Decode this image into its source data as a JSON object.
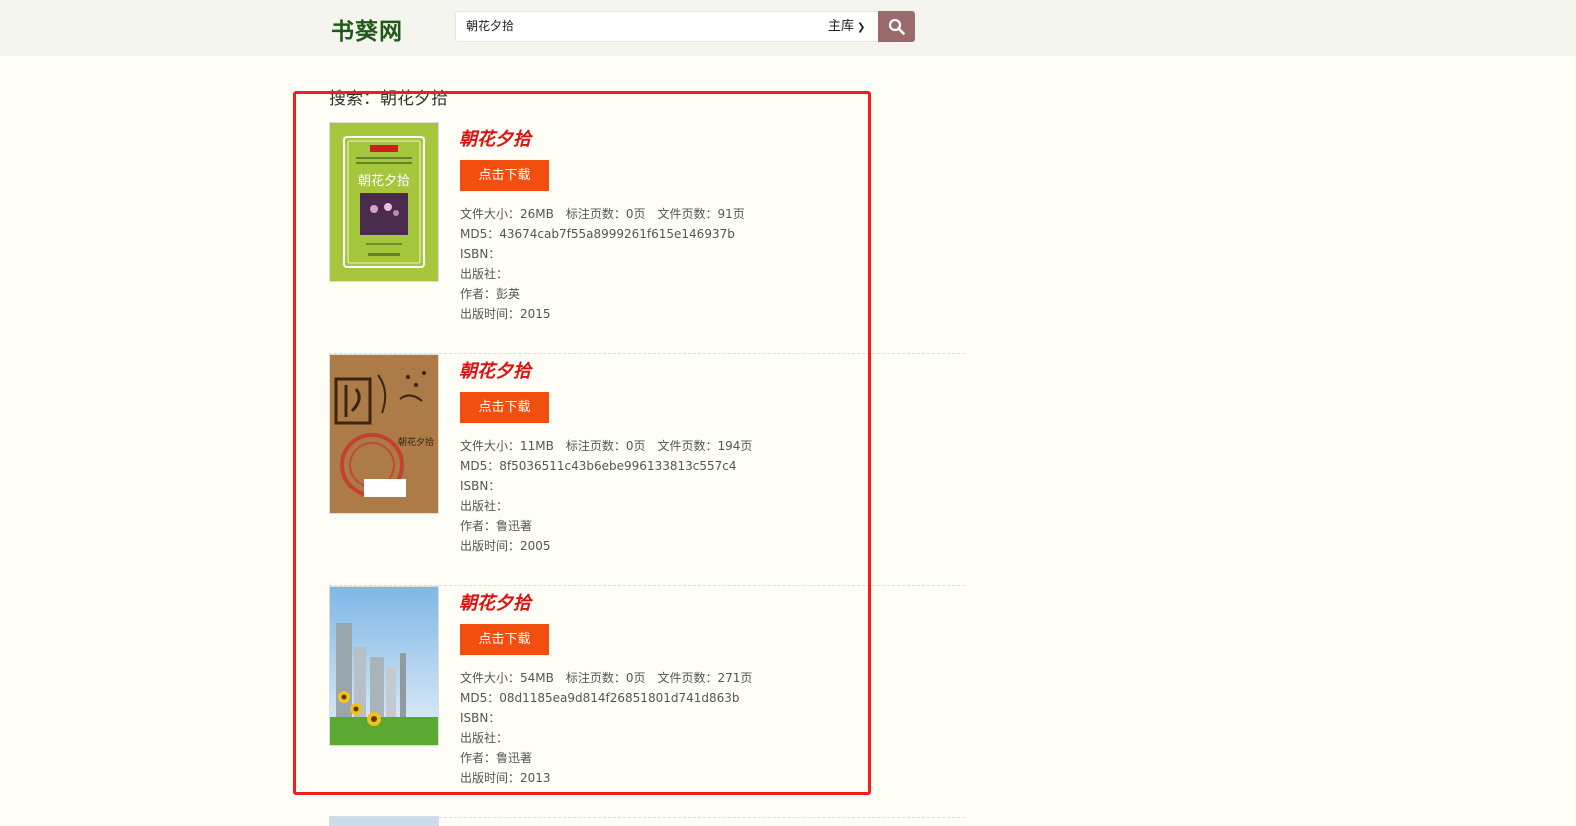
{
  "header": {
    "logo_text": "书葵网",
    "search_value": "朝花夕拾",
    "library_option": "主库"
  },
  "results": {
    "heading": "搜索：朝花夕拾",
    "items": [
      {
        "title": "朝花夕拾",
        "download_label": "点击下载",
        "size": "文件大小：26MB",
        "annotated_pages": "标注页数：0页",
        "file_pages": "文件页数：91页",
        "md5": "MD5：43674cab7f55a8999261f615e146937b",
        "isbn": "ISBN：",
        "publisher": "出版社：",
        "author": "作者：彭英",
        "pub_date": "出版时间：2015",
        "cover_title": "朝花夕拾"
      },
      {
        "title": "朝花夕拾",
        "download_label": "点击下载",
        "size": "文件大小：11MB",
        "annotated_pages": "标注页数：0页",
        "file_pages": "文件页数：194页",
        "md5": "MD5：8f5036511c43b6ebe996133813c557c4",
        "isbn": "ISBN：",
        "publisher": "出版社：",
        "author": "作者：鲁迅著",
        "pub_date": "出版时间：2005",
        "cover_title": "朝花夕拾"
      },
      {
        "title": "朝花夕拾",
        "download_label": "点击下载",
        "size": "文件大小：54MB",
        "annotated_pages": "标注页数：0页",
        "file_pages": "文件页数：271页",
        "md5": "MD5：08d1185ea9d814f26851801d741d863b",
        "isbn": "ISBN：",
        "publisher": "出版社：",
        "author": "作者：鲁迅著",
        "pub_date": "出版时间：2013"
      }
    ]
  },
  "colors": {
    "accent_download": "#f14e0f",
    "title_red": "#e01010",
    "highlight_border": "#ee1f1f",
    "logo_green": "#1f5b16",
    "search_button": "#9b6b6b"
  }
}
